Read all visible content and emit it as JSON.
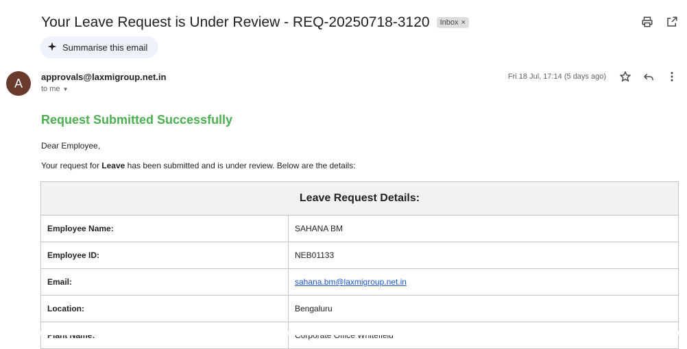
{
  "email": {
    "subject": "Your Leave Request is Under Review - REQ-20250718-3120",
    "label_chip": "Inbox",
    "label_chip_close": "×",
    "summarise_label": "Summarise this email",
    "avatar_letter": "A",
    "sender": "approvals@laxmigroup.net.in",
    "recipient": "to me",
    "datetime": "Fri 18 Jul, 17:14 (5 days ago)"
  },
  "icons": {
    "print": "print-icon",
    "open_new_window": "open-in-new-window-icon",
    "sparkle": "sparkle-icon",
    "star": "star-icon",
    "reply": "reply-icon",
    "more": "more-vertical-icon",
    "caret": "caret-down-icon"
  },
  "colors": {
    "heading_green": "#4caf50",
    "link_blue": "#1a55c9",
    "avatar_bg": "#6b3a2f",
    "summarise_bg": "#eef2f9"
  },
  "body": {
    "heading": "Request Submitted Successfully",
    "greeting": "Dear Employee,",
    "intro_prefix": "Your request for ",
    "intro_bold": "Leave",
    "intro_suffix": " has been submitted and is under review. Below are the details:"
  },
  "table": {
    "title": "Leave Request Details:",
    "rows": [
      {
        "label": "Employee Name:",
        "value": "SAHANA BM"
      },
      {
        "label": "Employee ID:",
        "value": "NEB01133"
      },
      {
        "label": "Email:",
        "value": "sahana.bm@laxmigroup.net.in"
      },
      {
        "label": "Location:",
        "value": "Bengaluru"
      },
      {
        "label": "Plant Name:",
        "value": "Corporate Office Whitefield"
      }
    ]
  }
}
